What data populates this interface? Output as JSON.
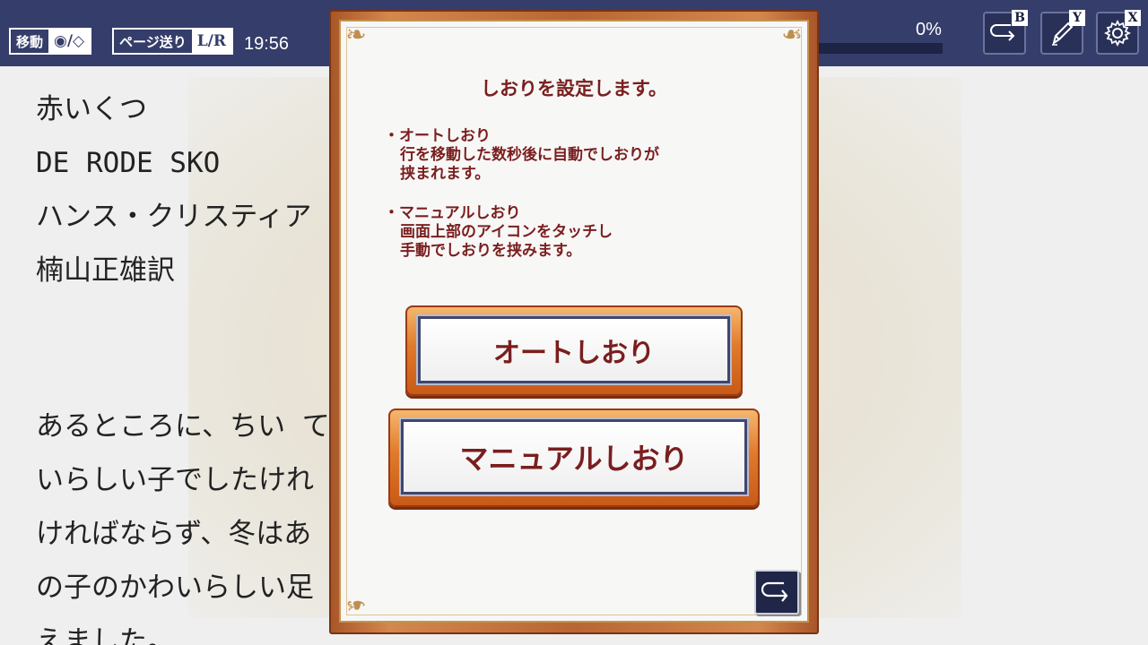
{
  "topbar": {
    "move_hint": {
      "label": "移動",
      "value": "◉/◇"
    },
    "page_hint": {
      "label": "ページ送り",
      "value": "L/R"
    },
    "clock": "19:56",
    "progress_text": "0%",
    "progress_value": 0,
    "buttons": [
      {
        "name": "back",
        "key": "B",
        "icon": "return-arrow-icon"
      },
      {
        "name": "pen",
        "key": "Y",
        "icon": "pen-icon"
      },
      {
        "name": "settings",
        "key": "X",
        "icon": "gear-icon"
      }
    ]
  },
  "page": {
    "lines": [
      "赤いくつ",
      "DE RODE SKO",
      "ハンス・クリスティア                  n Andersen",
      "楠山正雄訳"
    ],
    "body": [
      "  あるところに、ちい                    てもきれいなかわ",
      "いらしい子でしたけれ                    はだしであるかな",
      "ければならず、冬はあ                    ですから、その女",
      "の子のかわいらしい足                    にもいじらしく見",
      "えました。"
    ]
  },
  "modal": {
    "title": "しおりを設定します。",
    "auto_heading": "・オートしおり",
    "auto_desc_1": "行を移動した数秒後に自動でしおりが",
    "auto_desc_2": "挟まれます。",
    "manual_heading": "・マニュアルしおり",
    "manual_desc_1": "画面上部のアイコンをタッチし",
    "manual_desc_2": "手動でしおりを挟みます。",
    "auto_button": "オートしおり",
    "manual_button": "マニュアルしおり",
    "close_icon": "return-arrow-icon"
  },
  "colors": {
    "topbar": "#353d6a",
    "modal_text": "#7a1e1e",
    "frame_orange": "#d3884c"
  }
}
